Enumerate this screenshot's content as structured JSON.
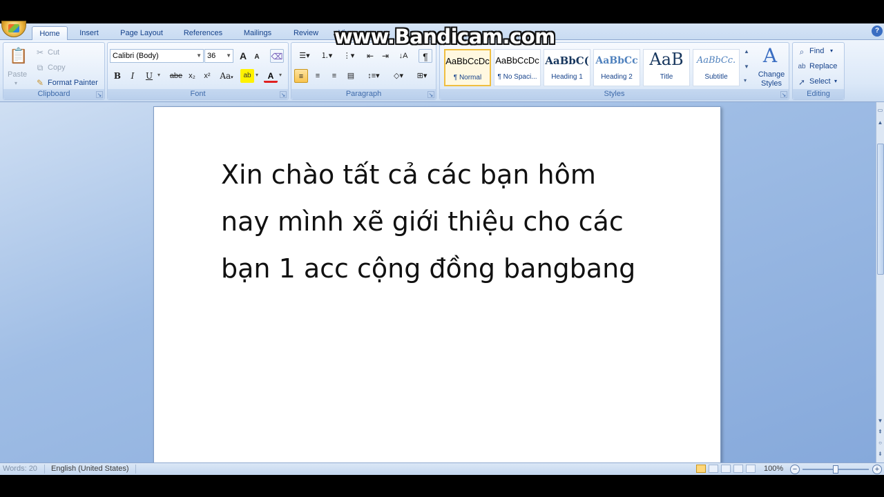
{
  "watermark": "www.Bandicam.com",
  "tabs": [
    "Home",
    "Insert",
    "Page Layout",
    "References",
    "Mailings",
    "Review",
    "View"
  ],
  "active_tab": "Home",
  "clipboard": {
    "paste_label": "Paste",
    "cut_label": "Cut",
    "copy_label": "Copy",
    "format_painter_label": "Format Painter",
    "group_label": "Clipboard"
  },
  "font": {
    "font_name": "Calibri (Body)",
    "font_size": "36",
    "group_label": "Font",
    "bold": "B",
    "italic": "I",
    "underline": "U",
    "strike": "abe",
    "subscript": "x₂",
    "superscript": "x²",
    "change_case": "Aa",
    "grow": "A",
    "shrink": "A"
  },
  "paragraph": {
    "group_label": "Paragraph",
    "pilcrow": "¶"
  },
  "styles": {
    "group_label": "Styles",
    "items": [
      {
        "sample": "AaBbCcDc",
        "name": "¶ Normal"
      },
      {
        "sample": "AaBbCcDc",
        "name": "¶ No Spaci..."
      },
      {
        "sample": "AaBbC(",
        "name": "Heading 1"
      },
      {
        "sample": "AaBbCc",
        "name": "Heading 2"
      },
      {
        "sample": "AaB",
        "name": "Title"
      },
      {
        "sample": "AaBbCc.",
        "name": "Subtitle"
      }
    ],
    "change_styles_label": "Change Styles"
  },
  "editing": {
    "group_label": "Editing",
    "find_label": "Find",
    "replace_label": "Replace",
    "select_label": "Select"
  },
  "document": {
    "lines": [
      "Xin chào tất cả các bạn hôm",
      "nay mình xẽ giới thiệu cho các",
      "bạn 1 acc cộng đồng bangbang"
    ]
  },
  "status": {
    "words": "Words: 20",
    "language": "English (United States)",
    "zoom": "100%"
  },
  "colors": {
    "ribbon_bg": "#dbe8f8",
    "accent_text": "#15428b",
    "doc_bg": "#9fbde5"
  }
}
